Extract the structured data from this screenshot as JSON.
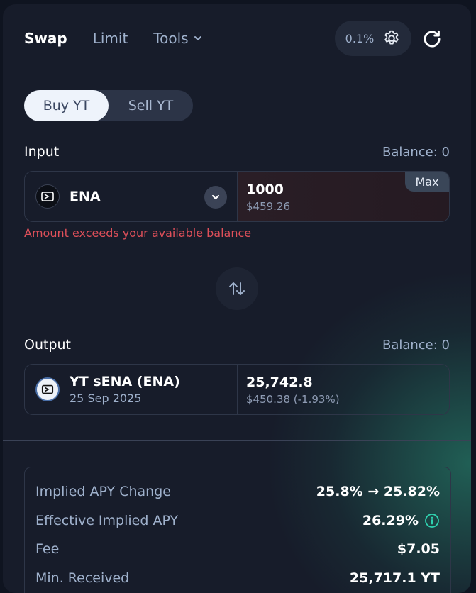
{
  "header": {
    "tabs": [
      {
        "label": "Swap"
      },
      {
        "label": "Limit"
      },
      {
        "label": "Tools"
      }
    ],
    "slippage": "0.1%"
  },
  "mode": {
    "buy": "Buy YT",
    "sell": "Sell YT"
  },
  "input": {
    "label": "Input",
    "balance": "Balance: 0",
    "token": "ENA",
    "amount": "1000",
    "usd": "$459.26",
    "max": "Max",
    "error": "Amount exceeds your available balance"
  },
  "output": {
    "label": "Output",
    "balance": "Balance: 0",
    "token": "YT sENA (ENA)",
    "maturity": "25 Sep 2025",
    "amount": "25,742.8",
    "usd": "$450.38 (-1.93%)"
  },
  "details": [
    {
      "key": "Implied APY Change",
      "value": "25.8% → 25.82%"
    },
    {
      "key": "Effective Implied APY",
      "value": "26.29%"
    },
    {
      "key": "Fee",
      "value": "$7.05"
    },
    {
      "key": "Min. Received",
      "value": "25,717.1 YT"
    }
  ],
  "colors": {
    "accent_teal": "#2fd3b0",
    "error": "#e0505a"
  },
  "icons": [
    "chevron-down-icon",
    "gear-icon",
    "refresh-icon",
    "ethena-logo-icon",
    "swap-arrows-icon",
    "info-icon"
  ]
}
